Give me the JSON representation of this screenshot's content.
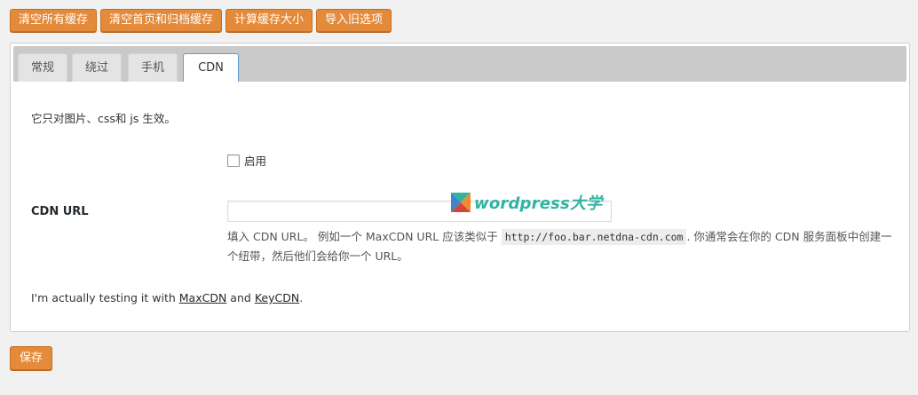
{
  "toolbar": {
    "clear_all_cache": "清空所有缓存",
    "clear_home_archive_cache": "清空首页和归档缓存",
    "calculate_cache_size": "计算缓存大小",
    "import_old_options": "导入旧选项"
  },
  "tabs": [
    {
      "label": "常规"
    },
    {
      "label": "绕过"
    },
    {
      "label": "手机"
    },
    {
      "label": "CDN"
    }
  ],
  "active_tab": "CDN",
  "cdn_tab": {
    "intro": "它只对图片、css和 js 生效。",
    "enable_label": "启用",
    "enable_checked": false,
    "url_label": "CDN URL",
    "url_value": "",
    "help_prefix": "填入 CDN URL。 例如一个 MaxCDN URL 应该类似于",
    "help_example": "http://foo.bar.netdna-cdn.com",
    "help_suffix": ". 你通常会在你的 CDN 服务面板中创建一个纽带，然后他们会给你一个 URL。",
    "testing_prefix": "I'm actually testing it with",
    "link_maxcdn": "MaxCDN",
    "testing_and": "and",
    "link_keycdn": "KeyCDN",
    "testing_suffix": "."
  },
  "save_label": "保存",
  "watermark": {
    "text": "wordpress大学",
    "icon": "wordpress-daxue-logo-icon"
  },
  "colors": {
    "button_orange": "#e38a3b",
    "tab_bar": "#c9c9c9",
    "active_tab_border": "#5b9dd9",
    "watermark_green": "#2fb3a3"
  }
}
